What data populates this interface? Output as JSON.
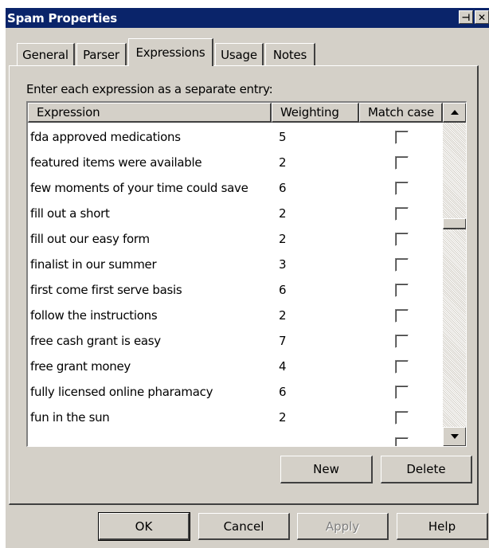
{
  "window": {
    "title": "Spam Properties",
    "pin_glyph": "⊣",
    "close_glyph": "✕"
  },
  "tabs": [
    {
      "label": "General",
      "active": false
    },
    {
      "label": "Parser",
      "active": false
    },
    {
      "label": "Expressions",
      "active": true
    },
    {
      "label": "Usage",
      "active": false
    },
    {
      "label": "Notes",
      "active": false
    }
  ],
  "instructions": "Enter each expression as a separate entry:",
  "table": {
    "columns": [
      "Expression",
      "Weighting",
      "Match case"
    ],
    "rows": [
      {
        "expression": "fda approved medications",
        "weighting": "5",
        "match_case": false
      },
      {
        "expression": "featured items were available",
        "weighting": "2",
        "match_case": false
      },
      {
        "expression": "few moments of your time could save",
        "weighting": "6",
        "match_case": false
      },
      {
        "expression": "fill out a short",
        "weighting": "2",
        "match_case": false
      },
      {
        "expression": "fill out our easy form",
        "weighting": "2",
        "match_case": false
      },
      {
        "expression": "finalist in our summer",
        "weighting": "3",
        "match_case": false
      },
      {
        "expression": "first come first serve basis",
        "weighting": "6",
        "match_case": false
      },
      {
        "expression": "follow the instructions",
        "weighting": "2",
        "match_case": false
      },
      {
        "expression": "free cash grant is easy",
        "weighting": "7",
        "match_case": false
      },
      {
        "expression": "free grant money",
        "weighting": "4",
        "match_case": false
      },
      {
        "expression": "fully licensed online pharamacy",
        "weighting": "6",
        "match_case": false
      },
      {
        "expression": "fun in the sun",
        "weighting": "2",
        "match_case": false
      },
      {
        "expression": "",
        "weighting": "",
        "match_case": false
      }
    ]
  },
  "list_buttons": {
    "new": "New",
    "delete": "Delete"
  },
  "dialog_buttons": {
    "ok": "OK",
    "cancel": "Cancel",
    "apply": "Apply",
    "help": "Help"
  },
  "colors": {
    "titlebar": "#0a246a",
    "face": "#d4d0c8"
  }
}
